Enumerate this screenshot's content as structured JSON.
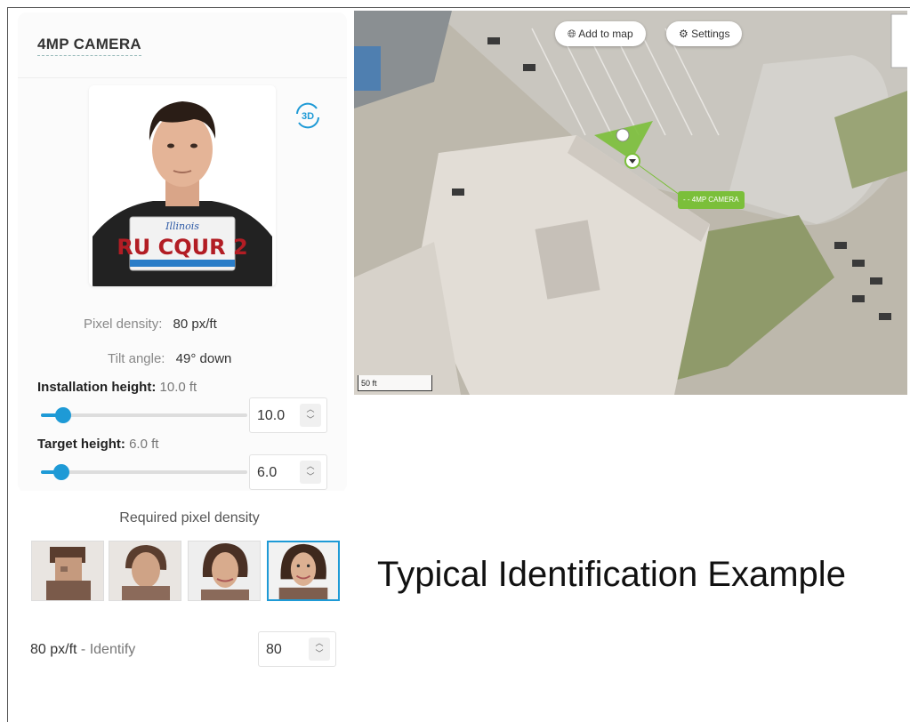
{
  "camera": {
    "title": "4MP CAMERA"
  },
  "preview": {
    "plate_state": "Illinois",
    "plate_text": "RU CQUR 2",
    "mode_icon": "3d-rotate-icon",
    "mode_label": "3D"
  },
  "stats": {
    "pixel_density_label": "Pixel density:",
    "pixel_density_value": "80 px/ft",
    "tilt_label": "Tilt angle:",
    "tilt_value": "49° down"
  },
  "installation_height": {
    "label": "Installation height:",
    "value_text": "10.0 ft",
    "input": "10.0",
    "level": 0.1
  },
  "target_height": {
    "label": "Target height:",
    "value_text": "6.0 ft",
    "input": "6.0",
    "level": 0.09
  },
  "density": {
    "title": "Required pixel density",
    "caption_value": "80 px/ft",
    "caption_sep": " - ",
    "caption_label": "Identify",
    "input": "80",
    "selected_index": 3
  },
  "map": {
    "add_label": "Add to map",
    "settings_label": "Settings",
    "scale_label": "50 ft",
    "camera_label": "- - 4MP CAMERA"
  },
  "example_title": "Typical Identification Example",
  "colors": {
    "accent": "#1e9ad6",
    "fov": "#7bbf3a"
  }
}
